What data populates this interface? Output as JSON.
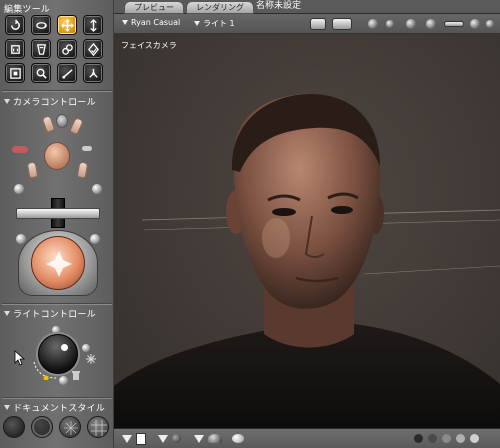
{
  "left_panel": {
    "edit_tools_label": "編集ツール",
    "camera_controls_label": "カメラコントロール",
    "light_controls_label": "ライトコントロール",
    "document_style_label": "ドキュメントスタイル",
    "tools": [
      {
        "icon": "rotate-icon"
      },
      {
        "icon": "twist-icon"
      },
      {
        "icon": "translate-icon"
      },
      {
        "icon": "translate-in-out-icon"
      },
      {
        "icon": "scale-icon"
      },
      {
        "icon": "taper-icon"
      },
      {
        "icon": "chain-break-icon"
      },
      {
        "icon": "color-icon"
      },
      {
        "icon": "grouping-icon"
      },
      {
        "icon": "view-magnifier-icon"
      },
      {
        "icon": "morph-brush-icon"
      },
      {
        "icon": "direct-manipulation-icon"
      }
    ],
    "active_tool": "translate-icon",
    "document_styles": [
      {
        "color": "#2a2a2a"
      },
      {
        "color": "#3a3a3a"
      },
      {
        "color": "#5a5a5a"
      },
      {
        "color": "#8a8a8a"
      }
    ]
  },
  "tabs": [
    {
      "label": "プレビュー"
    },
    {
      "label": "レンダリング"
    }
  ],
  "document_title": "名称未設定",
  "toolbar": {
    "figure_select": "Ryan Casual",
    "light_select": "ライト 1"
  },
  "viewport": {
    "camera_label": "フェイスカメラ"
  },
  "colors": {
    "active_tool": "#e39b00",
    "viewport_bg": "#3f3834",
    "skin": "#b27458"
  }
}
